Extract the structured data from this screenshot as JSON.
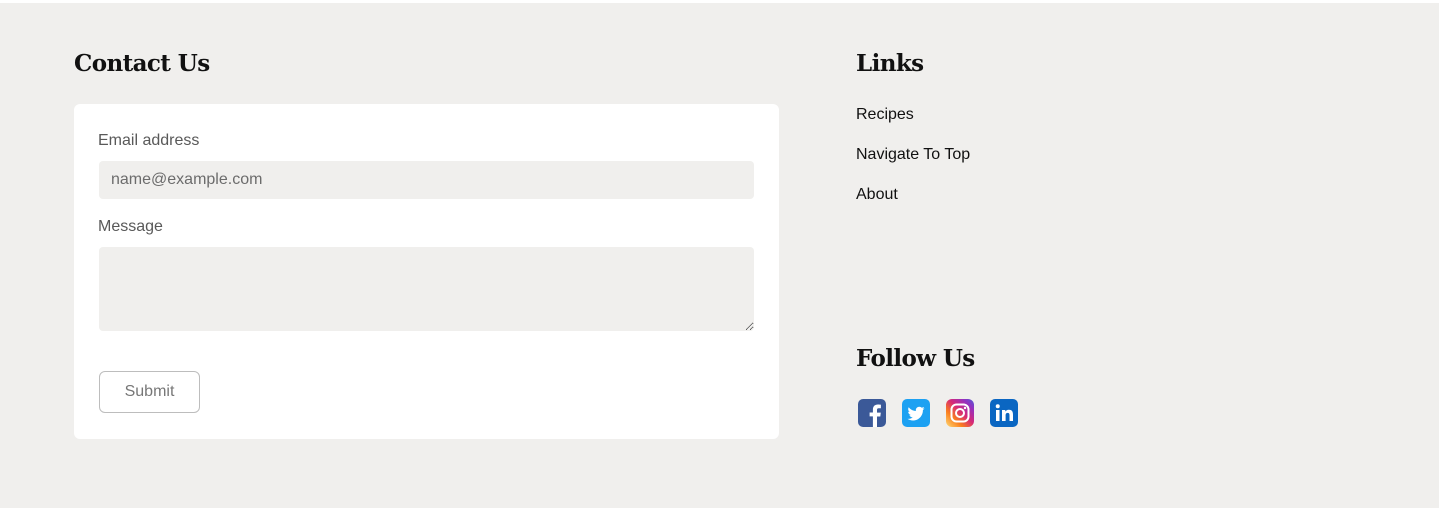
{
  "contact": {
    "heading": "Contact Us",
    "email_label": "Email address",
    "email_placeholder": "name@example.com",
    "email_value": "",
    "message_label": "Message",
    "message_value": "",
    "submit_label": "Submit"
  },
  "links": {
    "heading": "Links",
    "items": [
      {
        "label": "Recipes"
      },
      {
        "label": "Navigate To Top"
      },
      {
        "label": "About"
      }
    ]
  },
  "follow": {
    "heading": "Follow Us",
    "icons": [
      "facebook-icon",
      "twitter-icon",
      "instagram-icon",
      "linkedin-icon"
    ]
  },
  "colors": {
    "background": "#f0efed",
    "card": "#ffffff",
    "facebook": "#3b5998",
    "twitter": "#1da1f2",
    "linkedin": "#0a66c2"
  }
}
